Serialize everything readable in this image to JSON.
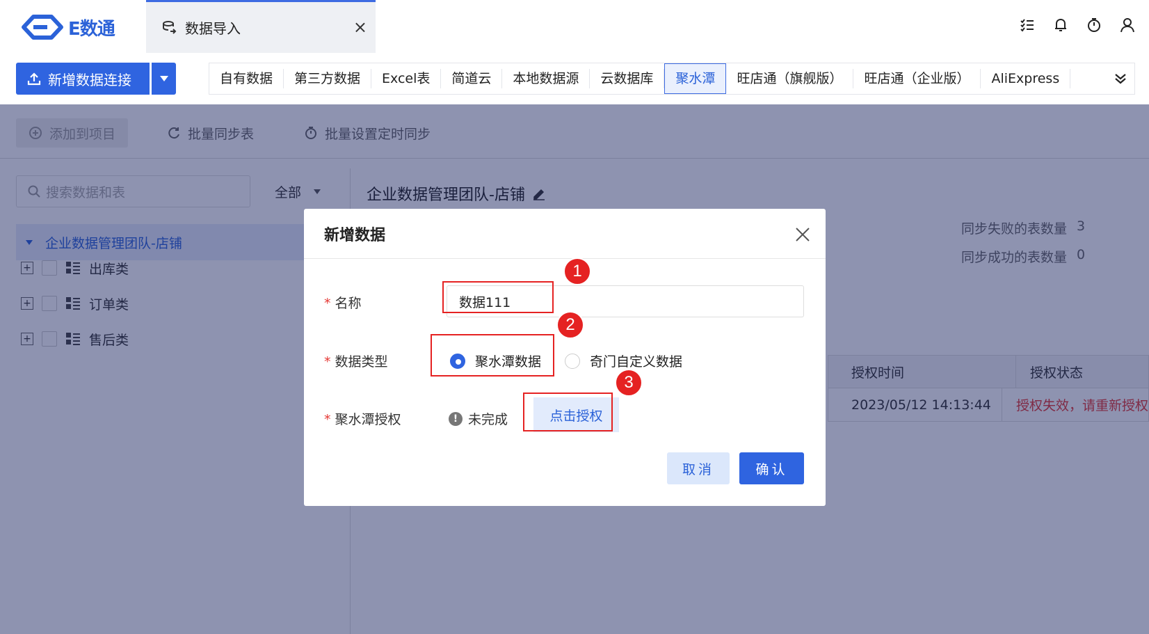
{
  "app": {
    "brand": "E数通"
  },
  "window_tab": {
    "label": "数据导入",
    "close": "×"
  },
  "actions": {
    "new_connection": "新增数据连接"
  },
  "source_tabs": [
    "自有数据",
    "第三方数据",
    "Excel表",
    "简道云",
    "本地数据源",
    "云数据库",
    "聚水潭",
    "旺店通（旗舰版）",
    "旺店通（企业版）",
    "AliExpress"
  ],
  "source_tabs_active": "聚水潭",
  "toolbar": {
    "add_to_project": "添加到项目",
    "batch_sync": "批量同步表",
    "batch_schedule": "批量设置定时同步"
  },
  "sidebar": {
    "search_placeholder": "搜索数据和表",
    "filter": "全部",
    "root": "企业数据管理团队-店铺",
    "items": [
      "出库类",
      "订单类",
      "售后类"
    ]
  },
  "detail": {
    "title": "企业数据管理团队-店铺",
    "sync_failed_label": "同步失败的表数量",
    "sync_failed_value": "3",
    "sync_success_label": "同步成功的表数量",
    "sync_success_value": "0",
    "table": {
      "headers": [
        "授权时间",
        "授权状态"
      ],
      "rows": [
        [
          "2023/05/12 14:13:44",
          "授权失效，请重新授权"
        ]
      ]
    }
  },
  "modal": {
    "title": "新增数据",
    "name_label": "名称",
    "name_value": "数据111",
    "type_label": "数据类型",
    "type_options": [
      "聚水潭数据",
      "奇门自定义数据"
    ],
    "type_selected": "聚水潭数据",
    "auth_label": "聚水潭授权",
    "auth_status": "未完成",
    "auth_button": "点击授权",
    "cancel": "取消",
    "confirm": "确认",
    "required_mark": "*"
  },
  "annotations": [
    "1",
    "2",
    "3"
  ],
  "colors": {
    "primary": "#2f64e0",
    "highlight": "#e52222",
    "error": "#e53935"
  }
}
